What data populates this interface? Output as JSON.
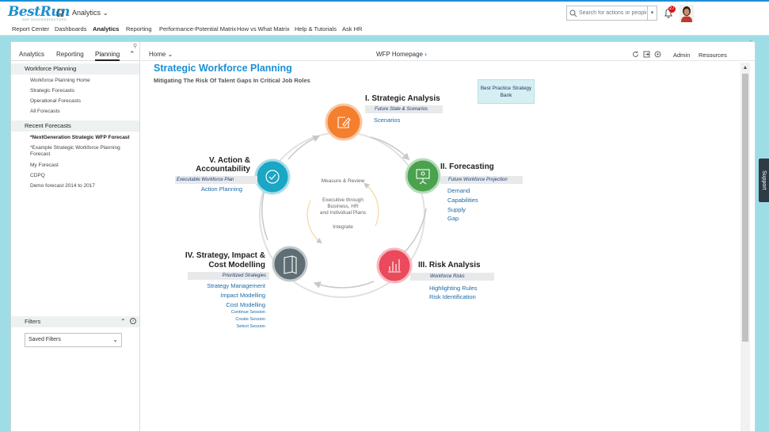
{
  "header": {
    "logo": "BestRun",
    "logo_tagline": "SAP SUCCESSFACTORS",
    "module": "Analytics",
    "search_placeholder": "Search for actions or people",
    "notification_count": "27"
  },
  "nav": [
    "Report Center",
    "Dashboards",
    "Analytics",
    "Reporting",
    "Performance-Potential Matrix",
    "How vs What Matrix",
    "Help & Tutorials",
    "Ask HR"
  ],
  "nav_active": "Analytics",
  "sidebar": {
    "tabs": [
      "Analytics",
      "Reporting",
      "Planning"
    ],
    "active_tab": "Planning",
    "workforce_planning": {
      "heading": "Workforce Planning",
      "items": [
        "Workforce Planning Home",
        "Strategic Forecasts",
        "Operational Forecasts",
        "All Forecasts"
      ]
    },
    "recent_forecasts": {
      "heading": "Recent Forecasts",
      "items": [
        "*NextGeneration Strategic WFP Forecast",
        "*Example Strategic Workforce Planning Forecast",
        "My Forecast",
        "CDPQ",
        "Demo forecast 2014 to 2017"
      ]
    },
    "filters": {
      "heading": "Filters",
      "saved_filters": "Saved Filters"
    }
  },
  "content": {
    "home_label": "Home",
    "breadcrumb": "WFP Homepage",
    "admin": "Admin",
    "resources": "Resources",
    "title": "Strategic Workforce Planning",
    "subtitle": "Mitigating The Risk Of Talent Gaps In Critical Job Roles",
    "best_practice": "Best Practice Strategy Bank"
  },
  "cycle": {
    "center_top": "Measure & Review",
    "center_mid_1": "Executive through",
    "center_mid_2": "Business, HR",
    "center_mid_3": "and Individual Plans",
    "center_bottom": "Integrate",
    "phases": [
      {
        "title": "I. Strategic Analysis",
        "subtitle": "Future State & Scenarios",
        "links": [
          "Scenarios"
        ],
        "color": "#f47f2e",
        "icon": "edit-icon"
      },
      {
        "title": "II. Forecasting",
        "subtitle": "Future Workforce Projection",
        "links": [
          "Demand",
          "Capabilities",
          "Supply",
          "Gap"
        ],
        "color": "#4aa24e",
        "icon": "presentation-icon"
      },
      {
        "title": "III. Risk Analysis",
        "subtitle": "Workforce Risks",
        "links": [
          "Highlighting Rules",
          "Risk Identification"
        ],
        "color": "#ea4a5b",
        "icon": "bar-chart-icon"
      },
      {
        "title_1": "IV. Strategy, Impact &",
        "title_2": "Cost Modelling",
        "subtitle": "Prioritized Strategies",
        "links": [
          "Strategy Management",
          "Impact Modelling",
          "Cost Modelling"
        ],
        "small_links": [
          "Continue Session",
          "Create Session",
          "Select Session"
        ],
        "color": "#5f6e75",
        "icon": "book-icon"
      },
      {
        "title_1": "V. Action &",
        "title_2": "Accountability",
        "subtitle": "Executable Workforce Plan",
        "links": [
          "Action Planning"
        ],
        "color": "#1aa6c4",
        "icon": "check-circle-icon"
      }
    ]
  },
  "support": "Support"
}
